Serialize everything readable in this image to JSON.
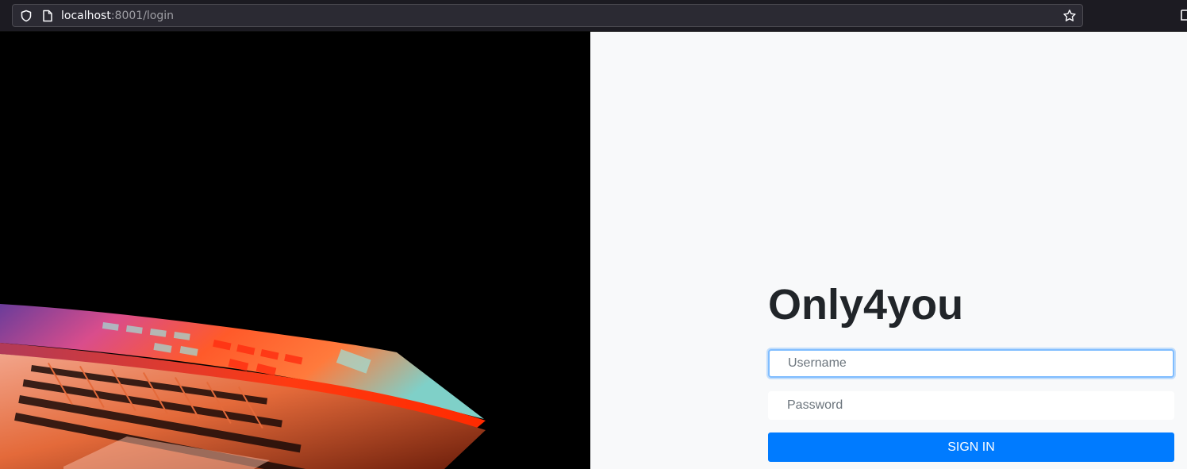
{
  "browser": {
    "url_host": "localhost",
    "url_path": ":8001/login"
  },
  "login": {
    "title": "Only4you",
    "username_placeholder": "Username",
    "password_placeholder": "Password",
    "signin_label": "SIGN IN"
  },
  "colors": {
    "primary": "#007bff",
    "focus_border": "#80bdff",
    "page_bg": "#f8f9fa",
    "title": "#212529"
  },
  "icons": [
    "shield-icon",
    "page-icon",
    "star-icon",
    "extension-icon"
  ]
}
